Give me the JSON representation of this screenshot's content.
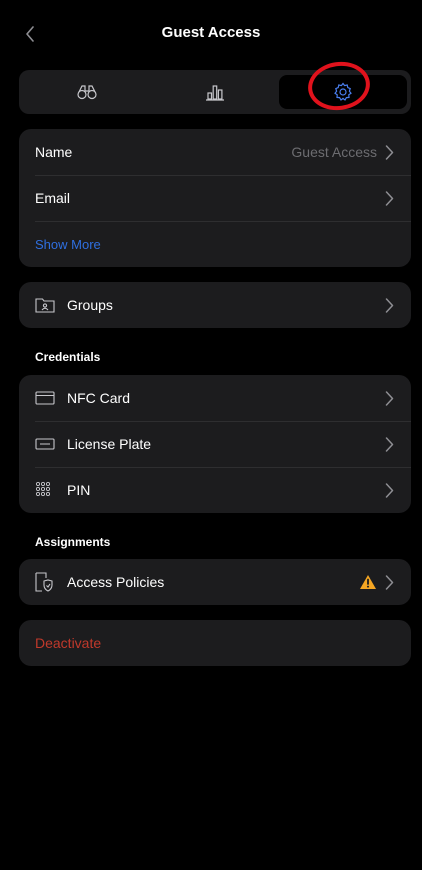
{
  "header": {
    "title": "Guest Access"
  },
  "tabs": [
    {
      "icon": "binoculars-icon",
      "active": false
    },
    {
      "icon": "bar-chart-icon",
      "active": false
    },
    {
      "icon": "gear-icon",
      "active": true
    }
  ],
  "profile": {
    "name_label": "Name",
    "name_value": "Guest Access",
    "email_label": "Email",
    "show_more": "Show More"
  },
  "groups": {
    "label": "Groups"
  },
  "credentials": {
    "title": "Credentials",
    "items": [
      {
        "label": "NFC Card",
        "icon": "card-icon"
      },
      {
        "label": "License Plate",
        "icon": "license-plate-icon"
      },
      {
        "label": "PIN",
        "icon": "keypad-icon"
      }
    ]
  },
  "assignments": {
    "title": "Assignments",
    "access_policies": "Access Policies"
  },
  "deactivate": {
    "label": "Deactivate"
  },
  "colors": {
    "background": "#000000",
    "card": "#1c1c1e",
    "link": "#2f6fe0",
    "danger": "#c0392b",
    "warning": "#f5a623",
    "annotation": "#e0121c"
  }
}
